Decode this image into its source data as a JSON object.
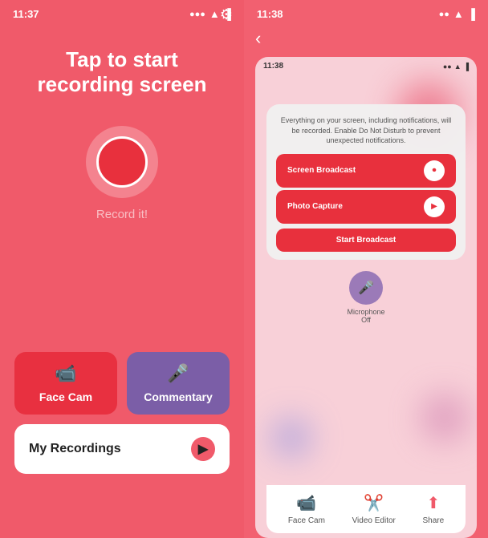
{
  "left_phone": {
    "status_time": "11:37",
    "headline": "Tap to start recording screen",
    "record_label": "Record it!",
    "gear_icon": "⚙",
    "face_cam_label": "Face Cam",
    "commentary_label": "Commentary",
    "my_recordings_label": "My Recordings",
    "play_icon": "▶"
  },
  "right_phone": {
    "status_time": "11:38",
    "back_icon": "‹",
    "inner_status_time": "11:38",
    "broadcast_notice": "Everything on your screen, including notifications, will be recorded. Enable Do Not Disturb to prevent unexpected notifications.",
    "screen_broadcast_label": "Screen Broadcast",
    "photo_capture_label": "Photo Capture",
    "start_broadcast_label": "Start Broadcast",
    "microphone_label": "Microphone\nOff",
    "nav_face_cam_label": "Face Cam",
    "nav_video_editor_label": "Video Editor",
    "nav_share_label": "Share"
  }
}
